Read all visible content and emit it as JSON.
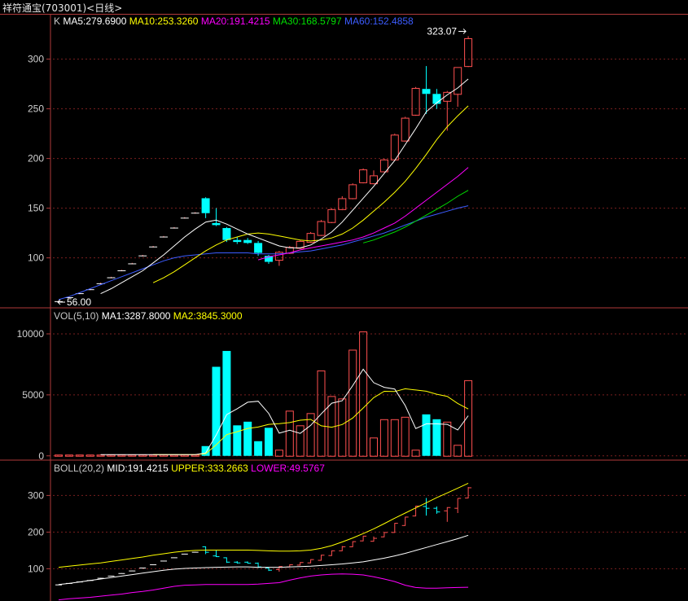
{
  "window": {
    "title": "祥符通宝(703001)<日线>"
  },
  "colors": {
    "up": "#ff5050",
    "down": "#00ffff",
    "ma5": "#ffffff",
    "ma10": "#ffff00",
    "ma20": "#ff00ff",
    "ma30": "#00e000",
    "ma60": "#3c5cff",
    "grid": "#7a1f1f",
    "frame": "#b03a3a"
  },
  "chart_data": [
    {
      "panel": "kline",
      "type": "candlestick",
      "header_prefix": "K",
      "indicators": [
        {
          "label": "MA5:279.6900",
          "color": "#ffffff"
        },
        {
          "label": "MA10:253.3260",
          "color": "#ffff00"
        },
        {
          "label": "MA20:191.4215",
          "color": "#ff00ff"
        },
        {
          "label": "MA30:168.5797",
          "color": "#00e000"
        },
        {
          "label": "MA60:152.4858",
          "color": "#3c5cff"
        }
      ],
      "yticks": [
        100,
        150,
        200,
        250,
        300
      ],
      "ytick_labels": [
        "100",
        "150",
        "200",
        "250",
        "300"
      ],
      "ylim": [
        53,
        330
      ],
      "max_label": "323.07",
      "min_label": "56.00",
      "candles": [
        [
          56,
          57,
          55.5,
          56
        ],
        [
          60,
          61,
          59.5,
          60
        ],
        [
          64,
          65,
          63.5,
          64
        ],
        [
          68,
          69,
          67.5,
          68
        ],
        [
          74,
          75,
          73.5,
          74
        ],
        [
          80,
          81,
          79.5,
          80
        ],
        [
          87,
          88,
          86.5,
          87
        ],
        [
          94,
          95,
          93.5,
          94
        ],
        [
          102,
          103,
          101.5,
          102
        ],
        [
          111,
          112,
          110.5,
          111
        ],
        [
          121,
          122,
          120.5,
          121
        ],
        [
          130,
          131,
          129.5,
          130
        ],
        [
          140,
          141,
          139.5,
          140
        ],
        [
          145,
          146,
          144.5,
          145
        ],
        [
          160,
          161,
          140,
          145
        ],
        [
          135,
          150,
          132,
          133
        ],
        [
          130,
          131,
          116,
          118
        ],
        [
          118,
          121,
          114,
          116
        ],
        [
          118,
          120,
          114,
          115
        ],
        [
          115,
          117,
          102,
          105
        ],
        [
          102,
          103,
          94,
          96
        ],
        [
          98,
          107,
          92,
          106
        ],
        [
          105,
          112,
          104,
          111
        ],
        [
          110,
          118,
          109,
          117
        ],
        [
          116,
          126,
          115,
          125
        ],
        [
          123,
          138,
          122,
          137
        ],
        [
          136,
          150,
          135,
          149
        ],
        [
          149,
          162,
          148,
          160
        ],
        [
          160,
          175,
          159,
          174
        ],
        [
          176,
          190,
          175,
          189
        ],
        [
          175,
          188,
          174,
          183
        ],
        [
          187,
          200,
          186,
          199
        ],
        [
          199,
          225,
          198,
          224
        ],
        [
          218,
          242,
          217,
          241
        ],
        [
          244,
          272,
          243,
          271
        ],
        [
          270,
          293,
          245,
          265
        ],
        [
          265,
          270,
          250,
          255
        ],
        [
          258,
          268,
          228,
          267
        ],
        [
          265,
          292,
          252,
          292
        ],
        [
          293,
          323.07,
          292,
          321
        ]
      ],
      "ma5": [
        null,
        null,
        null,
        null,
        64,
        69,
        75,
        81,
        87,
        95,
        103,
        112,
        121,
        129,
        136,
        138,
        134,
        129,
        124,
        120,
        116,
        112,
        110,
        110,
        113,
        119,
        126,
        136,
        148,
        160,
        172,
        185,
        198,
        214,
        230,
        247,
        256,
        264,
        271,
        280
      ],
      "ma10": [
        null,
        null,
        null,
        null,
        null,
        null,
        null,
        null,
        null,
        75,
        80,
        86,
        93,
        100,
        107,
        113,
        118,
        121,
        124,
        125,
        124,
        122,
        120,
        118,
        117,
        118,
        120,
        124,
        130,
        138,
        147,
        156,
        166,
        177,
        190,
        204,
        219,
        232,
        243,
        253
      ],
      "ma20": [
        null,
        null,
        null,
        null,
        null,
        null,
        null,
        null,
        null,
        null,
        null,
        null,
        null,
        null,
        null,
        null,
        null,
        null,
        null,
        98,
        101,
        103,
        105,
        108,
        110,
        112,
        114,
        116,
        118,
        121,
        125,
        130,
        135,
        142,
        150,
        158,
        166,
        174,
        182,
        191
      ],
      "ma30": [
        null,
        null,
        null,
        null,
        null,
        null,
        null,
        null,
        null,
        null,
        null,
        null,
        null,
        null,
        null,
        null,
        null,
        null,
        null,
        null,
        null,
        null,
        null,
        null,
        null,
        null,
        null,
        null,
        null,
        115,
        118,
        122,
        126,
        131,
        137,
        143,
        149,
        155,
        162,
        168
      ],
      "ma60": [
        58,
        61,
        65,
        69,
        73,
        77,
        81,
        85,
        89,
        93,
        97,
        100,
        102,
        103,
        104,
        105,
        105,
        105,
        105,
        104,
        104,
        104,
        105,
        106,
        107,
        109,
        111,
        113,
        116,
        119,
        122,
        125,
        129,
        133,
        137,
        141,
        144,
        147,
        150,
        152.5
      ]
    },
    {
      "panel": "volume",
      "type": "bar",
      "header_prefix": "VOL(5,10)",
      "indicators": [
        {
          "label": "MA1:3287.8000",
          "color": "#ffffff"
        },
        {
          "label": "MA2:3845.3000",
          "color": "#ffff00"
        }
      ],
      "yticks": [
        0,
        5000,
        10000
      ],
      "ytick_labels": [
        "0",
        "5000",
        "10000"
      ],
      "ylim": [
        -150,
        10800
      ],
      "values": [
        100,
        100,
        100,
        100,
        100,
        100,
        100,
        100,
        100,
        100,
        100,
        100,
        100,
        100,
        800,
        7300,
        8600,
        2500,
        2800,
        1200,
        2300,
        500,
        3700,
        2500,
        3500,
        7000,
        4900,
        4700,
        8700,
        10200,
        1500,
        3000,
        3000,
        3200,
        500,
        3400,
        3000,
        2800,
        900,
        6200
      ],
      "ma5": [
        null,
        null,
        null,
        null,
        100,
        100,
        100,
        100,
        100,
        100,
        100,
        100,
        100,
        100,
        240,
        1700,
        3380,
        3860,
        4400,
        4480,
        3480,
        1860,
        2100,
        1840,
        2500,
        3440,
        4320,
        4520,
        5760,
        7100,
        6000,
        5620,
        5480,
        4120,
        2240,
        2620,
        2620,
        2580,
        2120,
        3287.8
      ],
      "ma10": [
        null,
        null,
        null,
        null,
        null,
        null,
        null,
        null,
        null,
        100,
        100,
        100,
        100,
        100,
        170,
        900,
        1740,
        1980,
        2250,
        2360,
        2580,
        2640,
        2730,
        2920,
        2990,
        2460,
        2350,
        2570,
        3100,
        3920,
        4770,
        5290,
        5270,
        5500,
        5400,
        5300,
        5050,
        4880,
        4300,
        3845.3
      ]
    },
    {
      "panel": "boll",
      "type": "line",
      "header_prefix": "BOLL(20,2)",
      "indicators": [
        {
          "label": "MID:191.4215",
          "color": "#ffffff"
        },
        {
          "label": "UPPER:333.2663",
          "color": "#ffff00"
        },
        {
          "label": "LOWER:49.5767",
          "color": "#ff00ff"
        }
      ],
      "yticks": [
        100,
        200,
        300
      ],
      "ytick_labels": [
        "100",
        "200",
        "300"
      ],
      "ylim": [
        12,
        352
      ],
      "mid": [
        57,
        60,
        64,
        68,
        72,
        76,
        80,
        84,
        88,
        92,
        96,
        99,
        101,
        102,
        103,
        104,
        104.5,
        105,
        105,
        104,
        104,
        104,
        105,
        106,
        107,
        109,
        111,
        113,
        116,
        119,
        124,
        129,
        135,
        142,
        150,
        158,
        166,
        174,
        182,
        191.4
      ],
      "upper": [
        104,
        107,
        110,
        113,
        116,
        120,
        124,
        128,
        132,
        137,
        141,
        145,
        148,
        150,
        151,
        151,
        151,
        151,
        151,
        150,
        149,
        148,
        148,
        149,
        151,
        156,
        163,
        173,
        184,
        196,
        209,
        223,
        238,
        252,
        266,
        280,
        294,
        307,
        320,
        333.3
      ],
      "lower": [
        15,
        18,
        20,
        22,
        25,
        28,
        31,
        35,
        38,
        42,
        47,
        52,
        55,
        56,
        57,
        57,
        57,
        57,
        57,
        58,
        60,
        62,
        69,
        75,
        80,
        83,
        85,
        86,
        85,
        83,
        78,
        72,
        65,
        55,
        49,
        47,
        47,
        48,
        49,
        49.6
      ]
    }
  ]
}
